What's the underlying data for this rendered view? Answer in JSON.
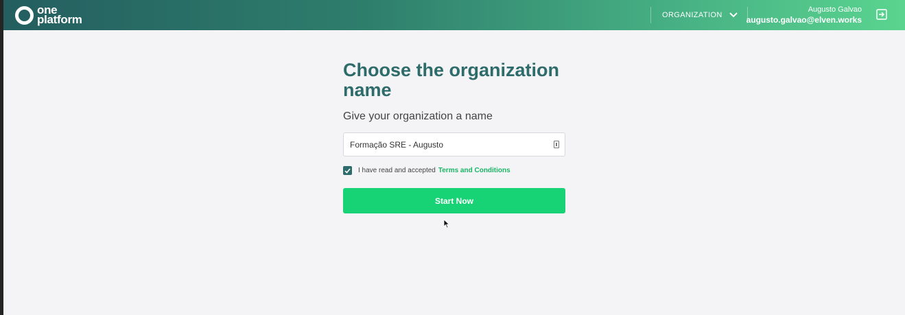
{
  "header": {
    "logo_line1": "one",
    "logo_line2": "platform",
    "org_menu_label": "ORGANIZATION",
    "user_name": "Augusto Galvao",
    "user_email": "augusto.galvao@elven.works",
    "icons": {
      "org_menu": "chevron-down-icon",
      "logout": "logout-icon",
      "logo": "circle-logo-icon"
    }
  },
  "form": {
    "title": "Choose the organization name",
    "subtitle": "Give your organization a name",
    "org_name_value": "Formação SRE - Augusto",
    "terms_text": "I have read and accepted",
    "terms_link": "Terms and Conditions",
    "terms_checked": true,
    "start_button": "Start Now"
  },
  "colors": {
    "title": "#2d6c6a",
    "accent": "#18d375",
    "link": "#19b765",
    "header_start": "#245e60",
    "header_end": "#5ad48f"
  }
}
